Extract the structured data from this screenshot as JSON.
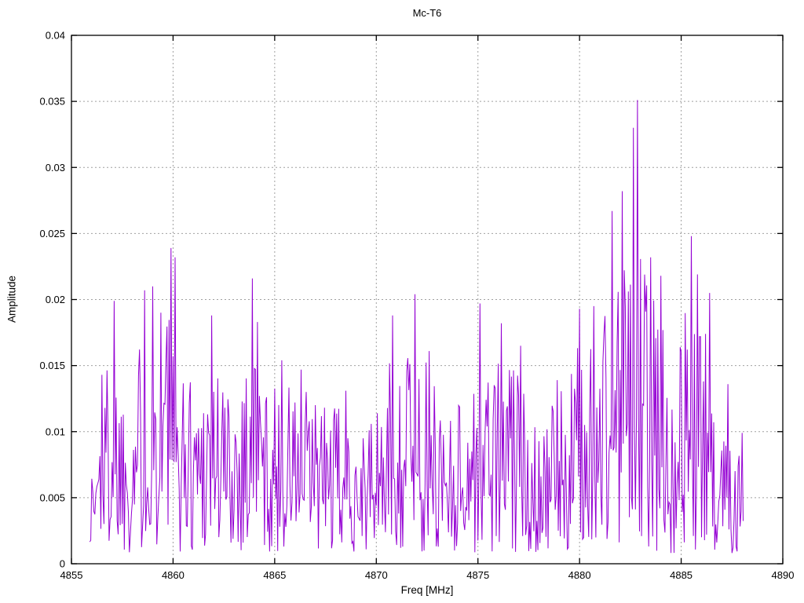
{
  "chart_data": {
    "type": "line",
    "title": "Mc-T6",
    "xlabel": "Freq [MHz]",
    "ylabel": "Amplitude",
    "xlim": [
      4855,
      4890
    ],
    "ylim": [
      0,
      0.04
    ],
    "xticks": {
      "values": [
        4855,
        4860,
        4865,
        4870,
        4875,
        4880,
        4885,
        4890
      ],
      "labels": [
        "4855",
        "4860",
        "4865",
        "4870",
        "4875",
        "4880",
        "4885",
        "4890"
      ]
    },
    "yticks": {
      "values": [
        0,
        0.005,
        0.01,
        0.015,
        0.02,
        0.025,
        0.03,
        0.035,
        0.04
      ],
      "labels": [
        "0",
        "0.005",
        "0.01",
        "0.015",
        "0.02",
        "0.025",
        "0.03",
        "0.035",
        "0.04"
      ]
    },
    "grid": {
      "visible": true,
      "style": "dashed",
      "color": "#a0a0a0"
    },
    "legend": {
      "visible": false
    },
    "frame_color": "#000000",
    "background_color": "#ffffff",
    "series": [
      {
        "name": "Mc-T6",
        "color": "#9400d3",
        "style": "lines",
        "x_start": 4855.9,
        "x_end": 4888.05,
        "x_step": 0.05,
        "seed": 1337,
        "noise_exponent": 1.15,
        "noise_floor": 0.0008,
        "envelope": [
          [
            4855.9,
            0.006
          ],
          [
            4856.5,
            0.013
          ],
          [
            4857.1,
            0.018
          ],
          [
            4857.6,
            0.013
          ],
          [
            4858.3,
            0.016
          ],
          [
            4859.0,
            0.019
          ],
          [
            4859.9,
            0.021
          ],
          [
            4860.5,
            0.0145
          ],
          [
            4861.2,
            0.014
          ],
          [
            4861.9,
            0.017
          ],
          [
            4862.6,
            0.013
          ],
          [
            4863.3,
            0.014
          ],
          [
            4863.9,
            0.018
          ],
          [
            4864.6,
            0.013
          ],
          [
            4865.3,
            0.013
          ],
          [
            4866.1,
            0.0135
          ],
          [
            4867.0,
            0.012
          ],
          [
            4868.0,
            0.0115
          ],
          [
            4869.0,
            0.0115
          ],
          [
            4870.0,
            0.01
          ],
          [
            4870.8,
            0.016
          ],
          [
            4871.9,
            0.017
          ],
          [
            4872.7,
            0.014
          ],
          [
            4873.6,
            0.012
          ],
          [
            4874.4,
            0.012
          ],
          [
            4875.1,
            0.016
          ],
          [
            4876.1,
            0.015
          ],
          [
            4877.1,
            0.014
          ],
          [
            4878.0,
            0.011
          ],
          [
            4878.9,
            0.012
          ],
          [
            4879.9,
            0.016
          ],
          [
            4880.7,
            0.017
          ],
          [
            4881.5,
            0.021
          ],
          [
            4882.2,
            0.023
          ],
          [
            4882.9,
            0.025
          ],
          [
            4883.6,
            0.02
          ],
          [
            4884.4,
            0.017
          ],
          [
            4885.2,
            0.019
          ],
          [
            4885.9,
            0.018
          ],
          [
            4886.6,
            0.016
          ],
          [
            4887.3,
            0.012
          ],
          [
            4888.05,
            0.008
          ]
        ],
        "notable_peaks": [
          [
            4856.5,
            0.0143
          ],
          [
            4857.1,
            0.0199
          ],
          [
            4858.6,
            0.0207
          ],
          [
            4859.0,
            0.021
          ],
          [
            4859.4,
            0.019
          ],
          [
            4859.9,
            0.0239
          ],
          [
            4860.1,
            0.0232
          ],
          [
            4861.9,
            0.0188
          ],
          [
            4863.9,
            0.0216
          ],
          [
            4864.15,
            0.0183
          ],
          [
            4865.35,
            0.0154
          ],
          [
            4866.3,
            0.0147
          ],
          [
            4868.5,
            0.0131
          ],
          [
            4870.05,
            0.0114
          ],
          [
            4870.8,
            0.0188
          ],
          [
            4871.9,
            0.0204
          ],
          [
            4872.6,
            0.0161
          ],
          [
            4875.1,
            0.0197
          ],
          [
            4876.15,
            0.0182
          ],
          [
            4877.1,
            0.0165
          ],
          [
            4878.9,
            0.0139
          ],
          [
            4880.0,
            0.0193
          ],
          [
            4880.7,
            0.0195
          ],
          [
            4881.6,
            0.0267
          ],
          [
            4882.1,
            0.0282
          ],
          [
            4882.65,
            0.033
          ],
          [
            4882.85,
            0.0351
          ],
          [
            4883.5,
            0.0232
          ],
          [
            4884.0,
            0.0218
          ],
          [
            4885.5,
            0.0248
          ],
          [
            4885.8,
            0.0219
          ],
          [
            4886.4,
            0.0205
          ],
          [
            4887.3,
            0.0136
          ],
          [
            4888.0,
            0.0099
          ]
        ]
      }
    ]
  }
}
